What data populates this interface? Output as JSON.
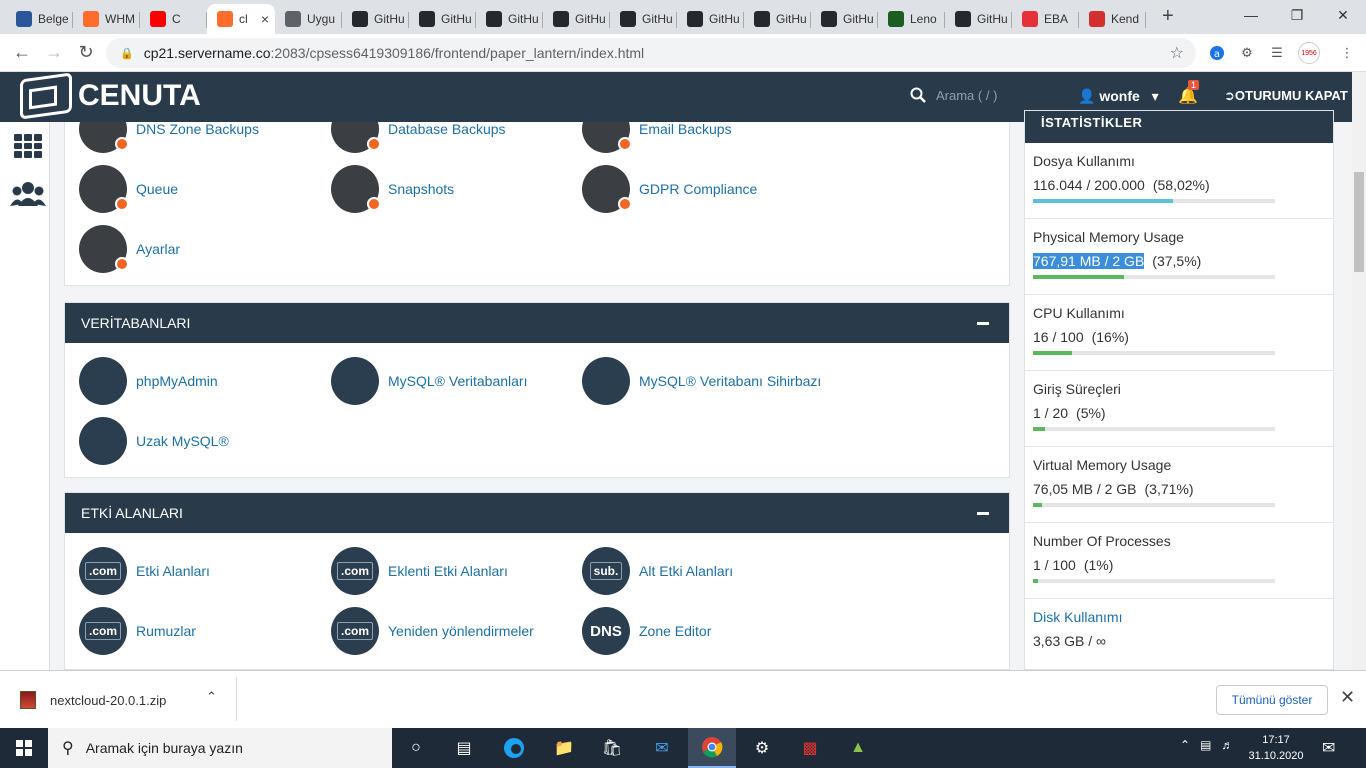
{
  "browser": {
    "tabs": [
      {
        "icon": "word-icon",
        "title": "Belge",
        "color": "#2b579a"
      },
      {
        "icon": "cpanel-icon",
        "title": "WHM",
        "color": "#ff6c2c"
      },
      {
        "icon": "youtube-icon",
        "title": "C",
        "color": "#ff0000"
      },
      {
        "icon": "cpanel-icon",
        "title": "cl",
        "color": "#ff6c2c",
        "active": true
      },
      {
        "icon": "globe-icon",
        "title": "Uygu",
        "color": "#5f6368"
      },
      {
        "icon": "github-icon",
        "title": "GitHu",
        "color": "#24292e"
      },
      {
        "icon": "github-icon",
        "title": "GitHu",
        "color": "#24292e"
      },
      {
        "icon": "github-icon",
        "title": "GitHu",
        "color": "#24292e"
      },
      {
        "icon": "github-icon",
        "title": "GitHu",
        "color": "#24292e"
      },
      {
        "icon": "github-icon",
        "title": "GitHu",
        "color": "#24292e"
      },
      {
        "icon": "github-icon",
        "title": "GitHu",
        "color": "#24292e"
      },
      {
        "icon": "github-icon",
        "title": "GitHu",
        "color": "#24292e"
      },
      {
        "icon": "github-icon",
        "title": "GitHu",
        "color": "#24292e"
      },
      {
        "icon": "lenovo-icon",
        "title": "Leno",
        "color": "#1b5e20"
      },
      {
        "icon": "github-icon",
        "title": "GitHu",
        "color": "#24292e"
      },
      {
        "icon": "ebay-icon",
        "title": "EBA",
        "color": "#e53238"
      },
      {
        "icon": "power-icon",
        "title": "Kend",
        "color": "#d32f2f"
      }
    ],
    "url_host": "cp21.servername.co",
    "url_rest": ":2083/cpsess6419309186/frontend/paper_lantern/index.html",
    "ext_badge": "1956"
  },
  "header": {
    "logo": "CENUTA",
    "search_placeholder": "Arama ( / )",
    "user": "wonfe",
    "notif_count": "1",
    "logout": "OTURUMU KAPAT"
  },
  "sections": {
    "files_items": [
      {
        "label": "DNS Zone Backups",
        "icon": "dns-backup-icon"
      },
      {
        "label": "Database Backups",
        "icon": "database-backup-icon"
      },
      {
        "label": "Email Backups",
        "icon": "email-backup-icon"
      },
      {
        "label": "Queue",
        "icon": "queue-icon"
      },
      {
        "label": "Snapshots",
        "icon": "snapshot-icon"
      },
      {
        "label": "GDPR Compliance",
        "icon": "gdpr-icon"
      },
      {
        "label": "Ayarlar",
        "icon": "settings-icon"
      }
    ],
    "db_title": "VERİTABANLARI",
    "db_items": [
      {
        "label": "phpMyAdmin",
        "icon": "phpmyadmin-icon"
      },
      {
        "label": "MySQL® Veritabanları",
        "icon": "mysql-icon"
      },
      {
        "label": "MySQL® Veritabanı Sihirbazı",
        "icon": "mysql-wizard-icon"
      },
      {
        "label": "Uzak MySQL®",
        "icon": "remote-mysql-icon"
      }
    ],
    "domains_title": "ETKİ ALANLARI",
    "domain_items": [
      {
        "label": "Etki Alanları",
        "icon": "domains-icon",
        "tag": ".com"
      },
      {
        "label": "Eklenti Etki Alanları",
        "icon": "addon-domains-icon",
        "tag": ".com"
      },
      {
        "label": "Alt Etki Alanları",
        "icon": "subdomains-icon",
        "tag": "sub."
      },
      {
        "label": "Rumuzlar",
        "icon": "aliases-icon",
        "tag": ".com"
      },
      {
        "label": "Yeniden yönlendirmeler",
        "icon": "redirects-icon",
        "tag": ".com"
      },
      {
        "label": "Zone Editor",
        "icon": "zone-editor-icon",
        "tag": "DNS"
      }
    ]
  },
  "stats": {
    "title": "İSTATİSTİKLER",
    "items": [
      {
        "label": "Dosya Kullanımı",
        "value": "116.044 / 200.000",
        "pct": "(58,02%)",
        "fraction": 0.5802,
        "color": "#5bc0de"
      },
      {
        "label": "Physical Memory Usage",
        "value": "767,91 MB / 2 GB",
        "pct": "(37,5%)",
        "fraction": 0.375,
        "color": "#5cb85c"
      },
      {
        "label": "CPU Kullanımı",
        "value": "16 / 100",
        "pct": "(16%)",
        "fraction": 0.16,
        "color": "#5cb85c"
      },
      {
        "label": "Giriş Süreçleri",
        "value": "1 / 20",
        "pct": "(5%)",
        "fraction": 0.05,
        "color": "#5cb85c"
      },
      {
        "label": "Virtual Memory Usage",
        "value": "76,05 MB / 2 GB",
        "pct": "(3,71%)",
        "fraction": 0.0371,
        "color": "#5cb85c"
      },
      {
        "label": "Number Of Processes",
        "value": "1 / 100",
        "pct": "(1%)",
        "fraction": 0.01,
        "color": "#5cb85c"
      },
      {
        "label": "Disk Kullanımı",
        "value": "3,63 GB / ∞",
        "pct": "",
        "fraction": null,
        "color": "#1d6fa5"
      }
    ]
  },
  "download": {
    "file": "nextcloud-20.0.1.zip",
    "show_all": "Tümünü göster"
  },
  "taskbar": {
    "search": "Aramak için buraya yazın",
    "time": "17:17",
    "date": "31.10.2020"
  }
}
